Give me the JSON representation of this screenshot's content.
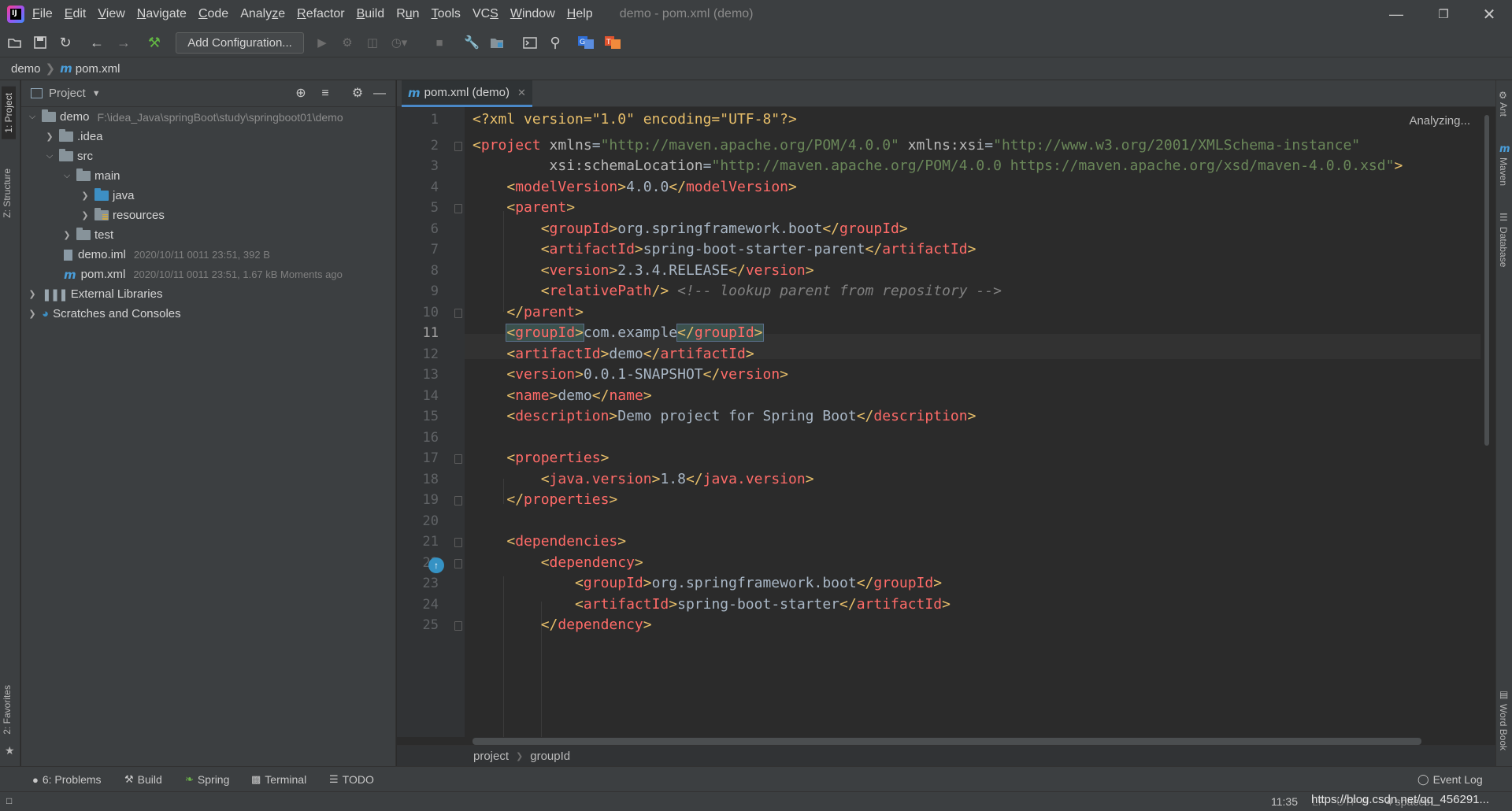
{
  "menu": {
    "items": [
      {
        "label": "File",
        "mnemonic": "F",
        "rest": "ile"
      },
      {
        "label": "Edit",
        "mnemonic": "E",
        "rest": "dit"
      },
      {
        "label": "View",
        "mnemonic": "V",
        "rest": "iew"
      },
      {
        "label": "Navigate",
        "mnemonic": "N",
        "rest": "avigate"
      },
      {
        "label": "Code",
        "mnemonic": "C",
        "rest": "ode"
      },
      {
        "label": "Analyze",
        "mnemonic": "",
        "rest": "Analyze"
      },
      {
        "label": "Refactor",
        "mnemonic": "R",
        "rest": "efactor"
      },
      {
        "label": "Build",
        "mnemonic": "B",
        "rest": "uild"
      },
      {
        "label": "Run",
        "mnemonic": "",
        "rest": "Run"
      },
      {
        "label": "Tools",
        "mnemonic": "T",
        "rest": "ools"
      },
      {
        "label": "VCS",
        "mnemonic": "",
        "rest": "VCS"
      },
      {
        "label": "Window",
        "mnemonic": "W",
        "rest": "indow"
      },
      {
        "label": "Help",
        "mnemonic": "H",
        "rest": "elp"
      }
    ],
    "window_title": "demo - pom.xml (demo)"
  },
  "toolbar": {
    "add_configuration": "Add Configuration..."
  },
  "navbar": {
    "project": "demo",
    "file": "pom.xml"
  },
  "left_strip": {
    "project": "1: Project",
    "structure": "Z: Structure",
    "favorites": "2: Favorites"
  },
  "project_panel": {
    "title": "Project",
    "tree": {
      "root": {
        "name": "demo",
        "path": "F:\\idea_Java\\springBoot\\study\\springboot01\\demo"
      },
      "idea": ".idea",
      "src": "src",
      "main": "main",
      "java": "java",
      "resources": "resources",
      "test": "test",
      "demo_iml": {
        "name": "demo.iml",
        "meta": "2020/10/11 0011 23:51, 392 B"
      },
      "pom_xml": {
        "name": "pom.xml",
        "meta": "2020/10/11 0011 23:51, 1.67 kB Moments ago"
      },
      "external_libraries": "External Libraries",
      "scratches": "Scratches and Consoles"
    }
  },
  "editor": {
    "tab_label": "pom.xml (demo)",
    "status": "Analyzing...",
    "current_line": 11,
    "line_numbers": [
      "1",
      "2",
      "3",
      "4",
      "5",
      "6",
      "7",
      "8",
      "9",
      "10",
      "11",
      "12",
      "13",
      "14",
      "15",
      "16",
      "17",
      "18",
      "19",
      "20",
      "21",
      "22",
      "23",
      "24",
      "25"
    ],
    "code": {
      "l1_decl": "<?xml version=\"1.0\" encoding=\"UTF-8\"?>",
      "l2_xmlns": "http://maven.apache.org/POM/4.0.0",
      "l2_xsi": "http://www.w3.org/2001/XMLSchema-instance",
      "l3_schema": "http://maven.apache.org/POM/4.0.0 https://maven.apache.org/xsd/maven-4.0.0.xsd",
      "l4_value": "4.0.0",
      "l6_value": "org.springframework.boot",
      "l7_value": "spring-boot-starter-parent",
      "l8_value": "2.3.4.RELEASE",
      "l9_comment": "<!-- lookup parent from repository -->",
      "l11_value": "com.example",
      "l12_value": "demo",
      "l13_value": "0.0.1-SNAPSHOT",
      "l14_value": "demo",
      "l15_value": "Demo project for Spring Boot",
      "l18_value": "1.8",
      "l23_value": "org.springframework.boot",
      "l24_value": "spring-boot-starter"
    },
    "breadcrumb": [
      "project",
      "groupId"
    ]
  },
  "right_strip": {
    "ant": "Ant",
    "maven": "Maven",
    "database": "Database",
    "word_book": "Word Book"
  },
  "bottom_tools": {
    "problems": "6: Problems",
    "build": "Build",
    "spring": "Spring",
    "terminal": "Terminal",
    "todo": "TODO",
    "event_log": "Event Log"
  },
  "statusbar": {
    "position": "11:35",
    "line_sep": "LF",
    "encoding": "UTF-8",
    "indent": "4 spaces",
    "watermark": "https://blog.csdn.net/qq_456291..."
  },
  "colors": {
    "accent": "#4a88c7",
    "tag_name": "#ff6b68",
    "string": "#6a8759",
    "text": "#a9b7c6",
    "comment": "#808080"
  }
}
